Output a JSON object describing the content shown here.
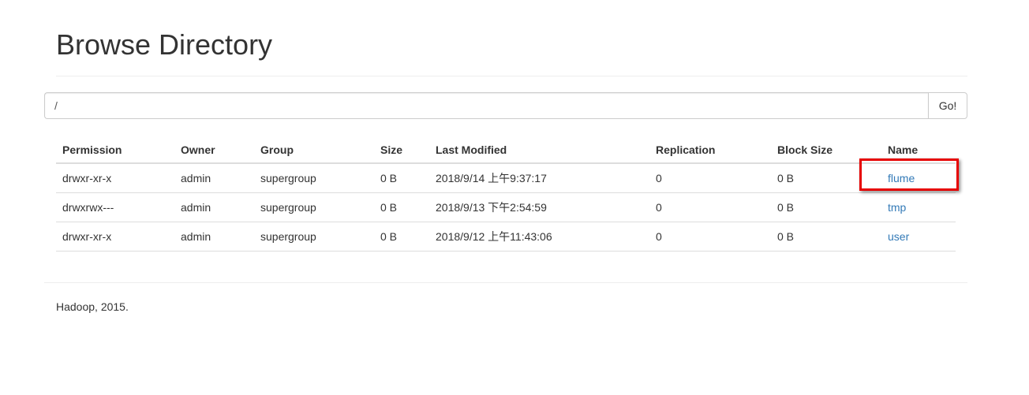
{
  "header": {
    "title": "Browse Directory"
  },
  "search": {
    "value": "/",
    "go_label": "Go!"
  },
  "table": {
    "columns": [
      "Permission",
      "Owner",
      "Group",
      "Size",
      "Last Modified",
      "Replication",
      "Block Size",
      "Name"
    ],
    "rows": [
      {
        "permission": "drwxr-xr-x",
        "owner": "admin",
        "group": "supergroup",
        "size": "0 B",
        "last_modified": "2018/9/14 上午9:37:17",
        "replication": "0",
        "block_size": "0 B",
        "name": "flume"
      },
      {
        "permission": "drwxrwx---",
        "owner": "admin",
        "group": "supergroup",
        "size": "0 B",
        "last_modified": "2018/9/13 下午2:54:59",
        "replication": "0",
        "block_size": "0 B",
        "name": "tmp"
      },
      {
        "permission": "drwxr-xr-x",
        "owner": "admin",
        "group": "supergroup",
        "size": "0 B",
        "last_modified": "2018/9/12 上午11:43:06",
        "replication": "0",
        "block_size": "0 B",
        "name": "user"
      }
    ]
  },
  "annotation": {
    "highlight_color": "#e60000",
    "highlighted_item": "flume"
  },
  "footer": {
    "text": "Hadoop, 2015."
  },
  "colors": {
    "link": "#337ab7",
    "text": "#333333"
  }
}
